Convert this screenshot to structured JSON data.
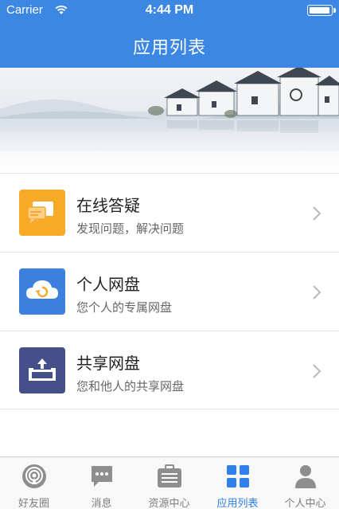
{
  "status_bar": {
    "carrier": "Carrier",
    "time": "4:44 PM",
    "battery_level": 1.0
  },
  "nav": {
    "title": "应用列表"
  },
  "colors": {
    "primary": "#3b87e3",
    "tab_active": "#2f80e8",
    "tab_inactive": "#7d7d7d",
    "qa_icon_bg": "#f7a928",
    "personal_disk_icon_bg": "#3b80dc",
    "shared_disk_icon_bg": "#454f8a"
  },
  "items": [
    {
      "title": "在线答疑",
      "subtitle": "发现问题，解决问题",
      "icon": "chat-bubbles-icon"
    },
    {
      "title": "个人网盘",
      "subtitle": "您个人的专属网盘",
      "icon": "cloud-sync-icon"
    },
    {
      "title": "共享网盘",
      "subtitle": "您和他人的共享网盘",
      "icon": "upload-tray-icon"
    }
  ],
  "tabs": [
    {
      "label": "好友圈",
      "icon": "podcast-circle-icon",
      "active": false
    },
    {
      "label": "消息",
      "icon": "chat-icon",
      "active": false
    },
    {
      "label": "资源中心",
      "icon": "briefcase-icon",
      "active": false
    },
    {
      "label": "应用列表",
      "icon": "grid-icon",
      "active": true
    },
    {
      "label": "个人中心",
      "icon": "person-icon",
      "active": false
    }
  ]
}
